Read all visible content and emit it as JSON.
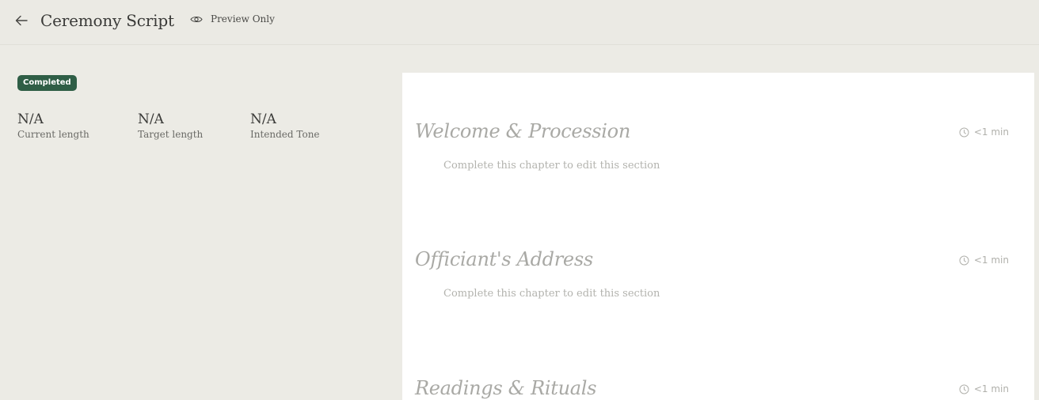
{
  "header": {
    "title": "Ceremony Script",
    "preview_label": "Preview Only"
  },
  "status": {
    "badge": "Completed",
    "badge_color": "#2f5e46"
  },
  "stats": [
    {
      "value": "N/A",
      "label": "Current length"
    },
    {
      "value": "N/A",
      "label": "Target length"
    },
    {
      "value": "N/A",
      "label": "Intended Tone"
    }
  ],
  "sections": [
    {
      "title": "Welcome & Procession",
      "time": "<1 min",
      "hint": "Complete this chapter to edit this section"
    },
    {
      "title": "Officiant's Address",
      "time": "<1 min",
      "hint": "Complete this chapter to edit this section"
    },
    {
      "title": "Readings & Rituals",
      "time": "<1 min",
      "hint": ""
    }
  ],
  "icons": {
    "back": "arrow-left-icon",
    "preview": "eye-icon",
    "time": "clock-icon"
  }
}
